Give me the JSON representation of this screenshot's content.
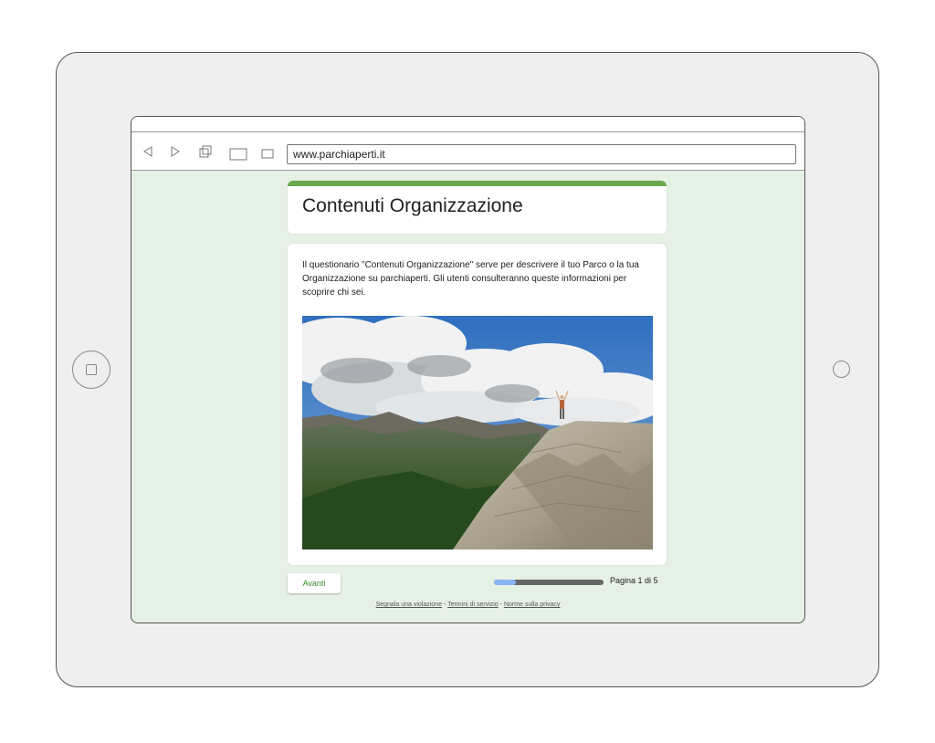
{
  "browser": {
    "url": "www.parchiaperti.it",
    "icons": [
      "back-icon",
      "forward-icon",
      "tabs-icon",
      "window-icon",
      "square-icon"
    ]
  },
  "form": {
    "title": "Contenuti Organizzazione",
    "description": "Il questionario \"Contenuti Organizzazione\" serve per descrivere il tuo Parco o la tua Organizzazione su parchiaperti. Gli utenti consulteranno queste informazioni per scoprire chi sei.",
    "next_label": "Avanti",
    "progress": 0.2,
    "page_label": "Pagina 1 di 5"
  },
  "footer": {
    "report": "Segnala una violazione",
    "terms": "Termini di servizio",
    "privacy": "Norme sulla privacy",
    "separator": " - "
  },
  "colors": {
    "accent": "#6aa84f",
    "background": "#e6f1e5",
    "progress_fill": "#8ab4f8",
    "progress_track": "#666666"
  }
}
